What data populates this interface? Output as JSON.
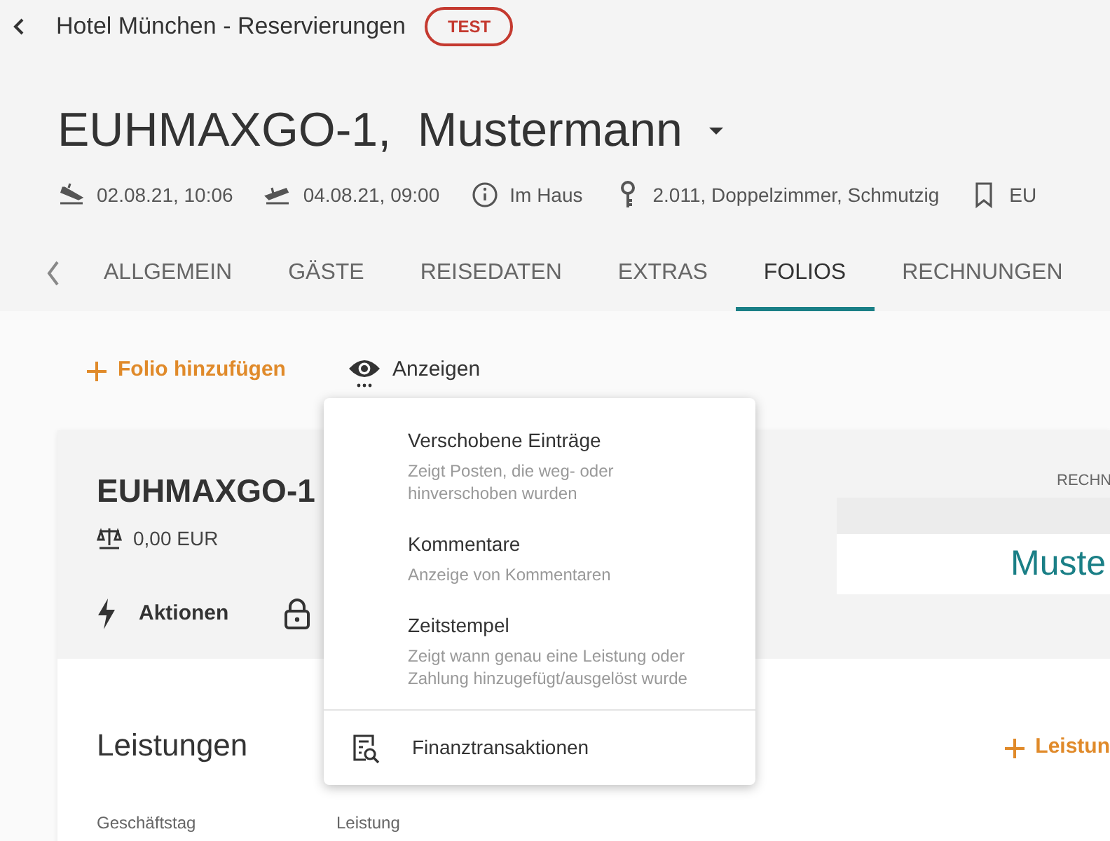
{
  "header": {
    "title": "Hotel München - Reservierungen",
    "badge": "TEST"
  },
  "reservation": {
    "code": "EUHMAXGO-1,",
    "name": "Mustermann",
    "meta": [
      {
        "kind": "arrival",
        "text": "02.08.21, 10:06"
      },
      {
        "kind": "departure",
        "text": "04.08.21, 09:00"
      },
      {
        "kind": "status",
        "text": "Im Haus"
      },
      {
        "kind": "room",
        "text": "2.011, Doppelzimmer, Schmutzig"
      },
      {
        "kind": "bookmark",
        "text": "EU"
      }
    ]
  },
  "tabs": [
    {
      "label": "ALLGEMEIN",
      "selected": false
    },
    {
      "label": "GÄSTE",
      "selected": false
    },
    {
      "label": "REISEDATEN",
      "selected": false
    },
    {
      "label": "EXTRAS",
      "selected": false
    },
    {
      "label": "FOLIOS",
      "selected": true
    },
    {
      "label": "RECHNUNGEN",
      "selected": false
    }
  ],
  "toolbar": {
    "add_label": "Folio hinzufügen",
    "view_label": "Anzeigen"
  },
  "folio": {
    "title": "EUHMAXGO-1",
    "balance": "0,00 EUR",
    "actions_label": "Aktionen",
    "column_label": "RECHN",
    "recipient": "Muste",
    "section_title": "Leistungen",
    "section_action": "Leistun",
    "columns": [
      "Geschäftstag",
      "Leistung"
    ]
  },
  "menu": {
    "items": [
      {
        "kind": "option",
        "title": "Verschobene Einträge",
        "description": "Zeigt Posten, die weg- oder hinverschoben wurden"
      },
      {
        "kind": "option",
        "title": "Kommentare",
        "description": "Anzeige von Kommentaren"
      },
      {
        "kind": "option",
        "title": "Zeitstempel",
        "description": "Zeigt wann genau eine Leistung oder Zahlung hinzugefügt/ausgelöst wurde"
      },
      {
        "kind": "link",
        "title": "Finanztransaktionen"
      }
    ]
  }
}
